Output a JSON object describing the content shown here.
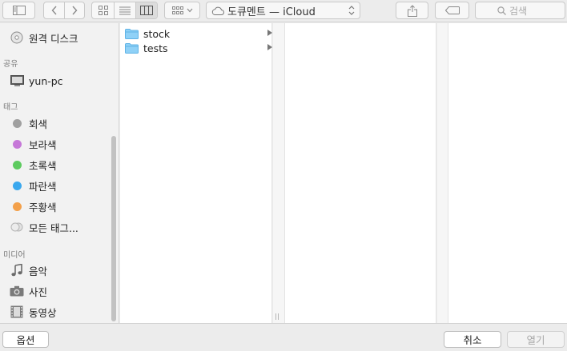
{
  "location": {
    "name": "도큐멘트 — iCloud"
  },
  "search": {
    "placeholder": "검색"
  },
  "sidebar": {
    "top_items": [
      {
        "label": "원격 디스크",
        "icon": "disc-icon"
      }
    ],
    "sections": {
      "shared": "공유",
      "tags": "태그",
      "media": "미디어"
    },
    "shared_items": [
      {
        "label": "yun-pc",
        "icon": "computer-icon"
      }
    ],
    "tag_items": [
      {
        "label": "회색",
        "color": "#a0a0a0"
      },
      {
        "label": "보라색",
        "color": "#c678d8"
      },
      {
        "label": "초록색",
        "color": "#5dcb5f"
      },
      {
        "label": "파란색",
        "color": "#3aa8ee"
      },
      {
        "label": "주황색",
        "color": "#f3a04a"
      },
      {
        "label": "모든 태그...",
        "color": "#d5d5d5"
      }
    ],
    "media_items": [
      {
        "label": "음악",
        "icon": "music-note-icon"
      },
      {
        "label": "사진",
        "icon": "camera-icon"
      },
      {
        "label": "동영상",
        "icon": "film-icon"
      }
    ]
  },
  "files": [
    {
      "name": "stock",
      "type": "folder"
    },
    {
      "name": "tests",
      "type": "folder"
    }
  ],
  "buttons": {
    "options": "옵션",
    "cancel": "취소",
    "open": "열기"
  },
  "colors": {
    "folder": "#6cc0f0",
    "accent": "#3a8ee6"
  }
}
